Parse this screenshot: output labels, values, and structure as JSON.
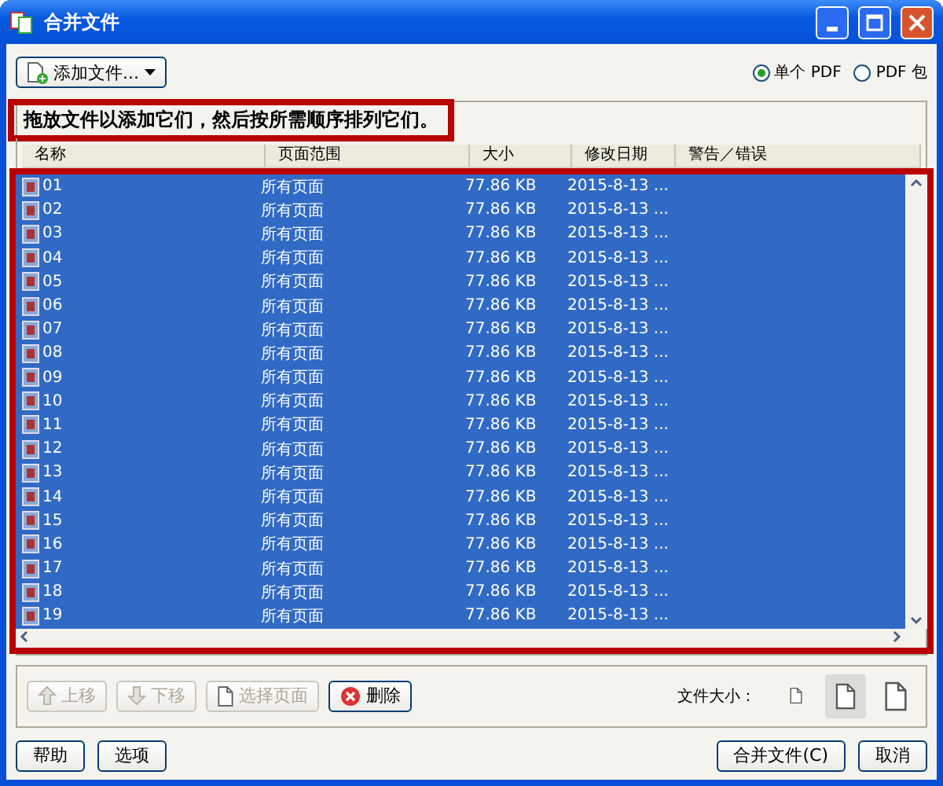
{
  "window": {
    "title": "合并文件"
  },
  "toolbar": {
    "add_button": "添加文件...",
    "output_options": [
      {
        "label": "单个 PDF",
        "selected": true
      },
      {
        "label": "PDF 包",
        "selected": false
      }
    ]
  },
  "instruction": {
    "text": "拖放文件以添加它们，然后按所需顺序排列它们。",
    "highlighted": true
  },
  "file_list": {
    "highlighted": true,
    "columns": [
      "名称",
      "页面范围",
      "大小",
      "修改日期",
      "警告／错误"
    ],
    "rows": [
      {
        "name": "01",
        "range": "所有页面",
        "size": "77.86 KB",
        "date": "2015-8-13 ...",
        "selected": true
      },
      {
        "name": "02",
        "range": "所有页面",
        "size": "77.86 KB",
        "date": "2015-8-13 ...",
        "selected": true
      },
      {
        "name": "03",
        "range": "所有页面",
        "size": "77.86 KB",
        "date": "2015-8-13 ...",
        "selected": true
      },
      {
        "name": "04",
        "range": "所有页面",
        "size": "77.86 KB",
        "date": "2015-8-13 ...",
        "selected": true
      },
      {
        "name": "05",
        "range": "所有页面",
        "size": "77.86 KB",
        "date": "2015-8-13 ...",
        "selected": true
      },
      {
        "name": "06",
        "range": "所有页面",
        "size": "77.86 KB",
        "date": "2015-8-13 ...",
        "selected": true
      },
      {
        "name": "07",
        "range": "所有页面",
        "size": "77.86 KB",
        "date": "2015-8-13 ...",
        "selected": true
      },
      {
        "name": "08",
        "range": "所有页面",
        "size": "77.86 KB",
        "date": "2015-8-13 ...",
        "selected": true
      },
      {
        "name": "09",
        "range": "所有页面",
        "size": "77.86 KB",
        "date": "2015-8-13 ...",
        "selected": true
      },
      {
        "name": "10",
        "range": "所有页面",
        "size": "77.86 KB",
        "date": "2015-8-13 ...",
        "selected": true
      },
      {
        "name": "11",
        "range": "所有页面",
        "size": "77.86 KB",
        "date": "2015-8-13 ...",
        "selected": true
      },
      {
        "name": "12",
        "range": "所有页面",
        "size": "77.86 KB",
        "date": "2015-8-13 ...",
        "selected": true
      },
      {
        "name": "13",
        "range": "所有页面",
        "size": "77.86 KB",
        "date": "2015-8-13 ...",
        "selected": true
      },
      {
        "name": "14",
        "range": "所有页面",
        "size": "77.86 KB",
        "date": "2015-8-13 ...",
        "selected": true
      },
      {
        "name": "15",
        "range": "所有页面",
        "size": "77.86 KB",
        "date": "2015-8-13 ...",
        "selected": true
      },
      {
        "name": "16",
        "range": "所有页面",
        "size": "77.86 KB",
        "date": "2015-8-13 ...",
        "selected": true
      },
      {
        "name": "17",
        "range": "所有页面",
        "size": "77.86 KB",
        "date": "2015-8-13 ...",
        "selected": true
      },
      {
        "name": "18",
        "range": "所有页面",
        "size": "77.86 KB",
        "date": "2015-8-13 ...",
        "selected": true
      },
      {
        "name": "19",
        "range": "所有页面",
        "size": "77.86 KB",
        "date": "2015-8-13 ...",
        "selected": true
      }
    ]
  },
  "list_actions": [
    {
      "kind": "up",
      "label": "上移",
      "disabled": true
    },
    {
      "kind": "down",
      "label": "下移",
      "disabled": true
    },
    {
      "kind": "pages",
      "label": "选择页面",
      "disabled": true
    },
    {
      "kind": "delete",
      "label": "删除",
      "disabled": false
    }
  ],
  "file_size": {
    "label": "文件大小：",
    "options": [
      {
        "selected": false
      },
      {
        "selected": true
      },
      {
        "selected": false
      }
    ]
  },
  "footer": {
    "left_buttons": [
      "帮助",
      "选项"
    ],
    "right_buttons": [
      "合并文件(C)",
      "取消"
    ]
  }
}
